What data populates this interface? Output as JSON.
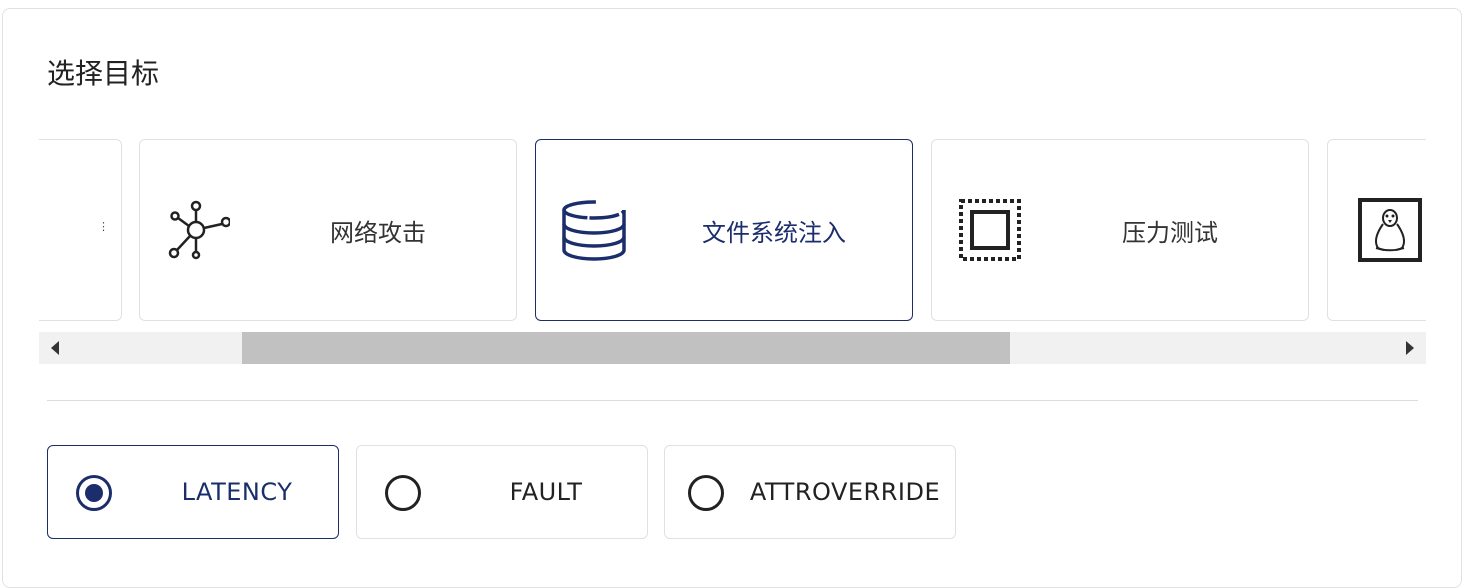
{
  "section": {
    "title": "选择目标"
  },
  "targets": [
    {
      "label": "",
      "icon": "partial-text-icon",
      "state": "clipped"
    },
    {
      "label": "网络攻击",
      "icon": "network-hub-icon"
    },
    {
      "label": "文件系统注入",
      "icon": "database-icon",
      "selected": true
    },
    {
      "label": "压力测试",
      "icon": "dotted-square-icon"
    },
    {
      "label": "",
      "icon": "linux-penguin-icon",
      "state": "clipped"
    }
  ],
  "scrollbar": {
    "left_arrow": "◀",
    "right_arrow": "▶"
  },
  "fault_types": [
    {
      "label": "LATENCY",
      "selected": true
    },
    {
      "label": "FAULT",
      "selected": false
    },
    {
      "label": "ATTROVERRIDE",
      "selected": false
    }
  ],
  "colors": {
    "accent": "#1b2d6b",
    "border": "#e1e1e1",
    "scroll_track": "#f1f1f1",
    "scroll_thumb": "#c1c1c1"
  }
}
